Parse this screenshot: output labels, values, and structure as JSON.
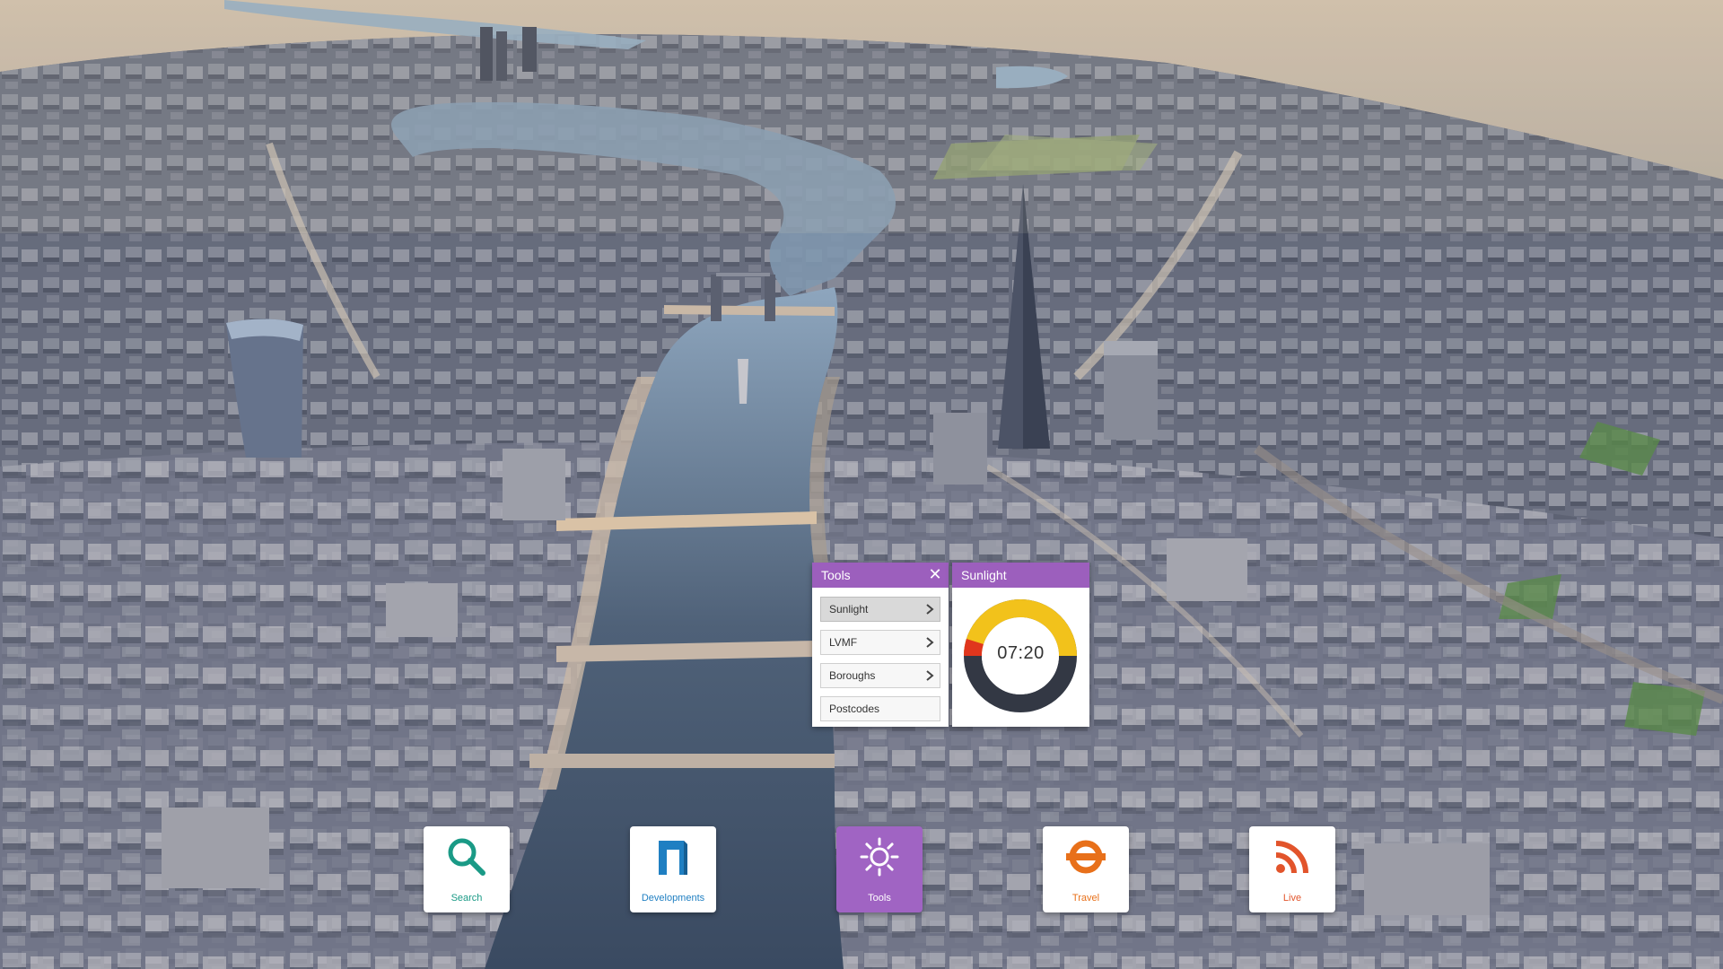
{
  "tools_panel": {
    "title": "Tools",
    "close_label": "✕",
    "items": [
      {
        "label": "Sunlight",
        "has_submenu": true,
        "active": true
      },
      {
        "label": "LVMF",
        "has_submenu": true,
        "active": false
      },
      {
        "label": "Boroughs",
        "has_submenu": true,
        "active": false
      },
      {
        "label": "Postcodes",
        "has_submenu": false,
        "active": false
      }
    ]
  },
  "sunlight_panel": {
    "title": "Sunlight",
    "time": "07:20",
    "dial_colors": {
      "day": "#f2c21b",
      "night": "#333844",
      "now": "#e0361d"
    }
  },
  "dock": {
    "buttons": [
      {
        "label": "Search",
        "icon": "magnifier-icon",
        "color": "#1a9a86",
        "active": false
      },
      {
        "label": "Developments",
        "icon": "developments-icon",
        "color": "#1f7fc2",
        "active": false
      },
      {
        "label": "Tools",
        "icon": "sun-icon",
        "color": "#ffffff",
        "active": true
      },
      {
        "label": "Travel",
        "icon": "roundel-icon",
        "color": "#e8701a",
        "active": false
      },
      {
        "label": "Live",
        "icon": "rss-icon",
        "color": "#e2542b",
        "active": false
      }
    ]
  }
}
